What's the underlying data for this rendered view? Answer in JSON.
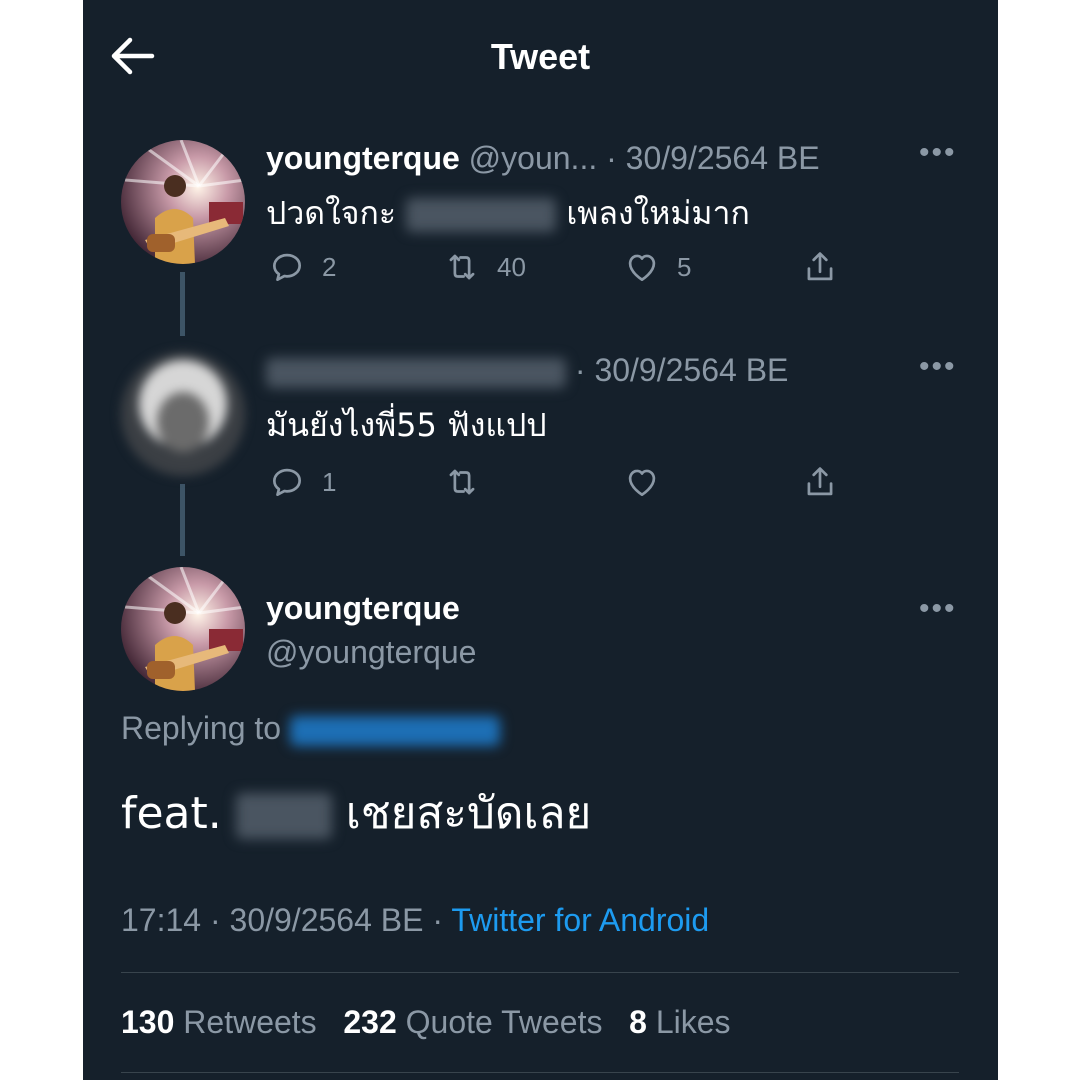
{
  "header": {
    "title": "Tweet"
  },
  "tweet1": {
    "display_name": "youngterque",
    "handle": "@youn...",
    "date": "· 30/9/2564 BE",
    "text_before": "ปวดใจกะ",
    "text_after": "เพลงใหม่มาก",
    "reply_count": "2",
    "retweet_count": "40",
    "like_count": "5"
  },
  "tweet2": {
    "date": "· 30/9/2564 BE",
    "text": "มันยังไงพี่55 ฟังแปป",
    "reply_count": "1"
  },
  "main_tweet": {
    "display_name": "youngterque",
    "handle": "@youngterque",
    "replying_to": "Replying to",
    "text_before": "feat.",
    "text_after": "เชยสะบัดเลย",
    "time": "17:14 · 30/9/2564 BE ·",
    "source": "Twitter for Android"
  },
  "stats": {
    "retweets_count": "130",
    "retweets_label": "Retweets",
    "quotes_count": "232",
    "quotes_label": "Quote Tweets",
    "likes_count": "8",
    "likes_label": "Likes"
  },
  "colors": {
    "background": "#15202b",
    "muted": "#8b98a5",
    "link": "#1d9bf0"
  },
  "icons": [
    "back-arrow-icon",
    "reply-icon",
    "retweet-icon",
    "like-icon",
    "share-icon",
    "more-icon"
  ]
}
